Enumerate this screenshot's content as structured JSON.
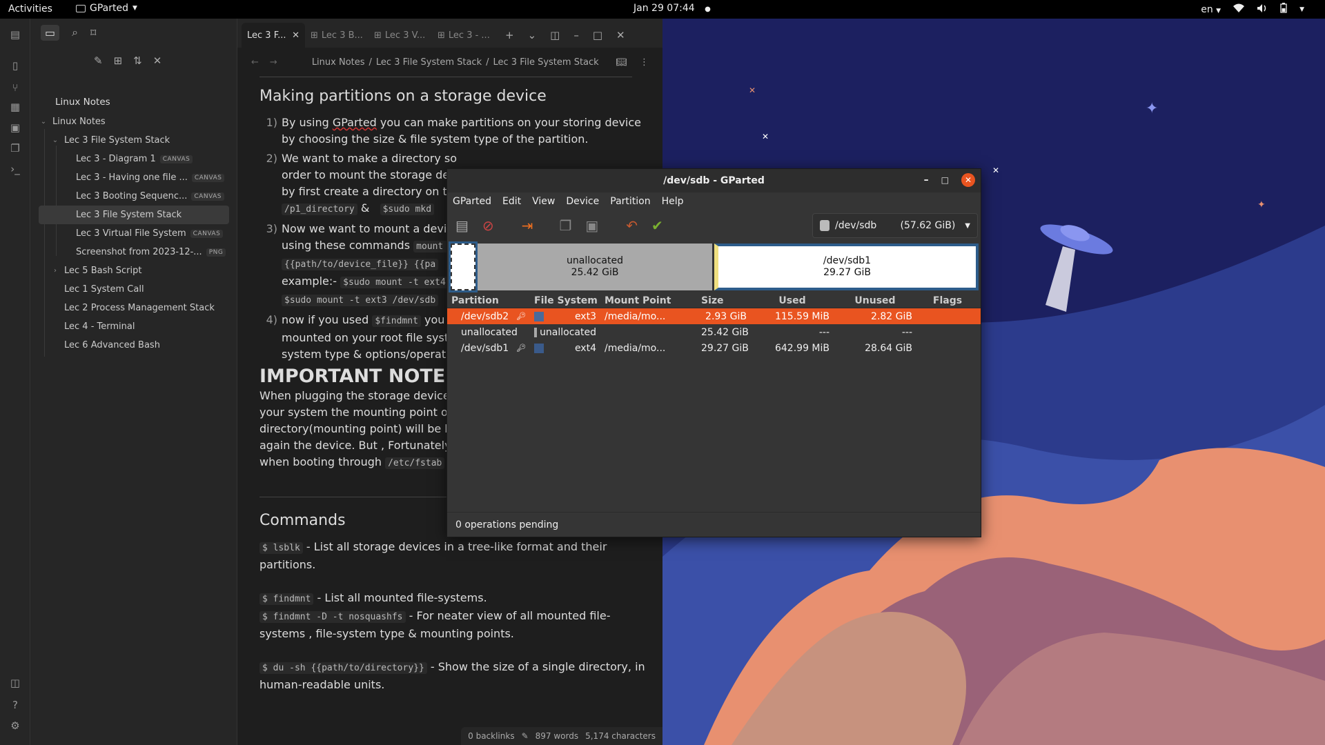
{
  "topbar": {
    "activities": "Activities",
    "app_name": "GParted",
    "clock": "Jan 29  07:44",
    "lang": "en"
  },
  "sidebar": {
    "vault_name": "Linux Notes",
    "items": [
      {
        "label": "Linux Notes",
        "badge": "",
        "level": 0,
        "chev": "v",
        "active": false
      },
      {
        "label": "Lec 3 File System Stack",
        "badge": "",
        "level": 1,
        "chev": "v",
        "active": false
      },
      {
        "label": "Lec 3 - Diagram 1",
        "badge": "CANVAS",
        "level": 2,
        "chev": "",
        "active": false
      },
      {
        "label": "Lec 3 - Having one file ...",
        "badge": "CANVAS",
        "level": 2,
        "chev": "",
        "active": false
      },
      {
        "label": "Lec 3 Booting Sequenc...",
        "badge": "CANVAS",
        "level": 2,
        "chev": "",
        "active": false
      },
      {
        "label": "Lec 3 File System Stack",
        "badge": "",
        "level": 2,
        "chev": "",
        "active": true
      },
      {
        "label": "Lec 3 Virtual File System",
        "badge": "CANVAS",
        "level": 2,
        "chev": "",
        "active": false
      },
      {
        "label": "Screenshot from 2023-12-...",
        "badge": "PNG",
        "level": 2,
        "chev": "",
        "active": false
      },
      {
        "label": "Lec 5 Bash Script",
        "badge": "",
        "level": 1,
        "chev": ">",
        "active": false
      },
      {
        "label": "Lec 1 System Call",
        "badge": "",
        "level": 1,
        "chev": "",
        "active": false
      },
      {
        "label": "Lec 2 Process Management Stack",
        "badge": "",
        "level": 1,
        "chev": "",
        "active": false
      },
      {
        "label": "Lec 4 - Terminal",
        "badge": "",
        "level": 1,
        "chev": "",
        "active": false
      },
      {
        "label": "Lec 6 Advanced Bash",
        "badge": "",
        "level": 1,
        "chev": "",
        "active": false
      }
    ]
  },
  "editor": {
    "tabs": [
      "Lec 3 F...",
      "Lec 3 B...",
      "Lec 3 V...",
      "Lec 3 - ..."
    ],
    "breadcrumb": [
      "Linux Notes",
      "Lec 3 File System Stack",
      "Lec 3 File System Stack"
    ],
    "heading1": "Making partitions on a storage device",
    "list": [
      {
        "n": "1)",
        "pre": "By using ",
        "link": "GParted",
        "post": " you can make partitions on your storing device by choosing the size & file system type of the partition."
      },
      {
        "n": "2)",
        "text": "We want to make a directory so",
        "line2": "order to mount the storage dev",
        "line3": "by first create a directory on the",
        "code1": "/p1_directory",
        "amp": "&",
        "code2": "$sudo mkd"
      },
      {
        "n": "3)",
        "text": "Now we want to mount a device",
        "line2": "using these commands",
        "code1": "mount -",
        "code2": "{{path/to/device_file}} {{pa",
        "ex": "example:-",
        "code3": "$sudo mount -t ext4",
        "code4": "$sudo mount -t ext3 /dev/sdb"
      },
      {
        "n": "4)",
        "text": "now if you used",
        "code1": "$findmnt",
        "text2": "you c",
        "line2": "mounted on your root file syster",
        "line3": "system type & options/operatio"
      }
    ],
    "important": "IMPORTANT NOTE :",
    "note_lines": [
      "When plugging the storage device f",
      "your system the mounting point of t",
      "directory(mounting point) will be bro",
      "again the device. But , Fortunately v"
    ],
    "note_last_pre": "when booting through",
    "note_last_code": "/etc/fstab",
    "heading2": "Commands",
    "commands": [
      {
        "code": "$ lsblk",
        "desc": " - List all storage devices in a tree-like format and their partitions."
      },
      {
        "code": "$ findmnt",
        "desc": "  - List all mounted file-systems."
      },
      {
        "code": "$ findmnt -D -t nosquashfs",
        "desc": " - For neater view of all mounted file-systems , file-system type & mounting points."
      },
      {
        "code": "$ du -sh {{path/to/directory}}",
        "desc": "  - Show the size of a single directory, in human-readable units."
      }
    ],
    "status": {
      "backlinks": "0 backlinks",
      "words": "897 words",
      "chars": "5,174 characters"
    }
  },
  "gparted": {
    "title": "/dev/sdb - GParted",
    "menu": [
      "GParted",
      "Edit",
      "View",
      "Device",
      "Partition",
      "Help"
    ],
    "device": "/dev/sdb",
    "device_size": "(57.62 GiB)",
    "graph": [
      {
        "name": "",
        "size": ""
      },
      {
        "name": "unallocated",
        "size": "25.42 GiB"
      },
      {
        "name": "/dev/sdb1",
        "size": "29.27 GiB"
      }
    ],
    "columns": [
      "Partition",
      "File System",
      "Mount Point",
      "Size",
      "Used",
      "Unused",
      "Flags"
    ],
    "rows": [
      {
        "partition": "/dev/sdb2",
        "fs": "ext3",
        "mount": "/media/mo...",
        "size": "2.93 GiB",
        "used": "115.59 MiB",
        "unused": "2.82 GiB",
        "flags": "",
        "color": "#4a6a9a",
        "key": true,
        "selected": true
      },
      {
        "partition": "unallocated",
        "fs": "unallocated",
        "mount": "",
        "size": "25.42 GiB",
        "used": "---",
        "unused": "---",
        "flags": "",
        "color": "#a9a9a9",
        "key": false,
        "selected": false
      },
      {
        "partition": "/dev/sdb1",
        "fs": "ext4",
        "mount": "/media/mo...",
        "size": "29.27 GiB",
        "used": "642.99 MiB",
        "unused": "28.64 GiB",
        "flags": "",
        "color": "#3a5a8a",
        "key": true,
        "selected": false
      }
    ],
    "footer": "0 operations pending"
  },
  "colors": {
    "accent": "#e95420",
    "desktop_bg": "#1c2060"
  }
}
